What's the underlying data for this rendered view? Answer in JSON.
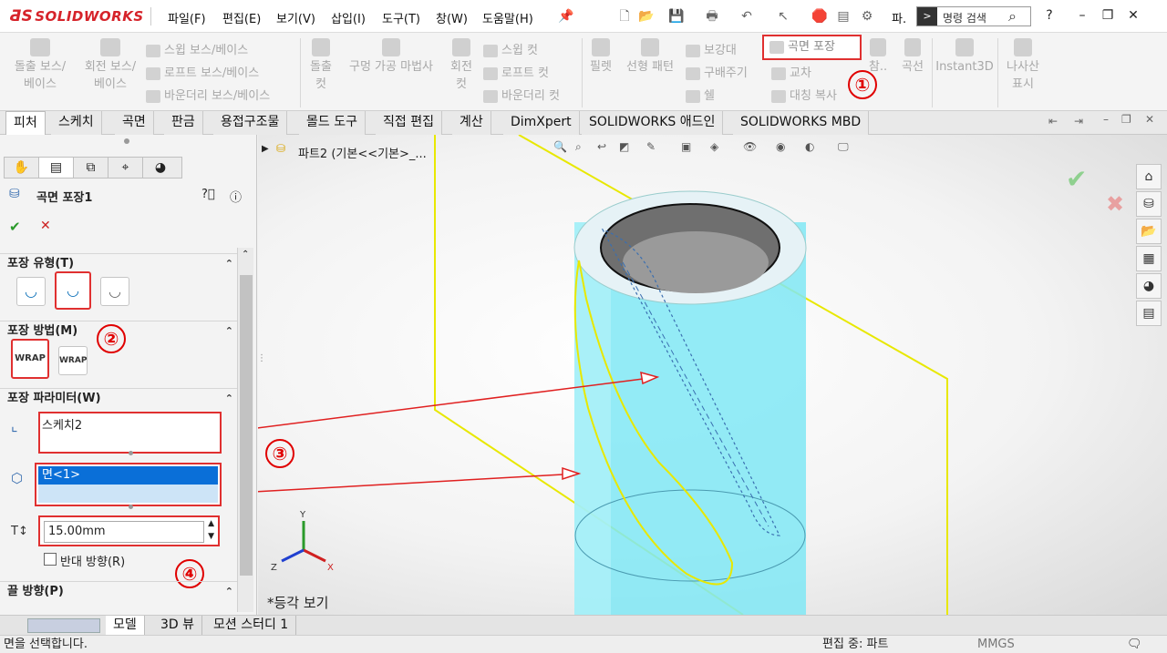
{
  "app": {
    "logo": "SOLIDWORKS"
  },
  "menu": [
    "파일(F)",
    "편집(E)",
    "보기(V)",
    "삽입(I)",
    "도구(T)",
    "창(W)",
    "도움말(H)"
  ],
  "quick_access": {
    "overflow_label": "파.",
    "search_placeholder": "명령 검색"
  },
  "ribbon": {
    "extrude_boss": "돌출 보스/\n베이스",
    "revolve_boss": "회전 보스/\n베이스",
    "sweep_boss": "스윕 보스/베이스",
    "loft_boss": "로프트 보스/베이스",
    "boundary_boss": "바운더리 보스/베이스",
    "extrude_cut": "돌출\n컷",
    "hole_wizard": "구멍 가공 마법사",
    "revolve_cut": "회전\n컷",
    "sweep_cut": "스윕 컷",
    "loft_cut": "로프트 컷",
    "boundary_cut": "바운더리 컷",
    "fillet": "필렛",
    "linear_pattern": "선형 패턴",
    "rib": "보강대",
    "draft": "구배주기",
    "shell": "쉘",
    "wrap": "곡면 포장",
    "intersect": "교차",
    "mirror": "대칭 복사",
    "ref_geom": "참..",
    "curves": "곡선",
    "instant3d": "Instant3D",
    "helix": "나사산\n표시"
  },
  "tabs": [
    "피처",
    "스케치",
    "곡면",
    "판금",
    "용접구조물",
    "몰드 도구",
    "직접 편집",
    "계산",
    "DimXpert",
    "SOLIDWORKS 애드인",
    "SOLIDWORKS MBD"
  ],
  "active_tab": "피처",
  "property_manager": {
    "title": "곡면 포장1",
    "wrap_type_label": "포장 유형(T)",
    "wrap_method_label": "포장 방법(M)",
    "wrap_params_label": "포장 파라미터(W)",
    "sketch_value": "스케치2",
    "face_value": "면<1>",
    "thickness_value": "15.00mm",
    "reverse_label": "반대 방향(R)",
    "pull_dir_label": "끌 방향(P)"
  },
  "tree": {
    "part_label": "파트2  (기본<<기본>_..."
  },
  "view": {
    "label": "*등각 보기"
  },
  "callouts": [
    "①",
    "②",
    "③",
    "④"
  ],
  "bottom_tabs": [
    "모델",
    "3D 뷰",
    "모션 스터디 1"
  ],
  "status": {
    "message": "면을 선택합니다.",
    "editing": "편집 중: 파트",
    "units": "MMGS"
  },
  "colors": {
    "accent_red": "#e03030",
    "cylinder": "#7fe6f2",
    "sketch_yellow": "#e8e800",
    "logo_red": "#d6232a"
  }
}
